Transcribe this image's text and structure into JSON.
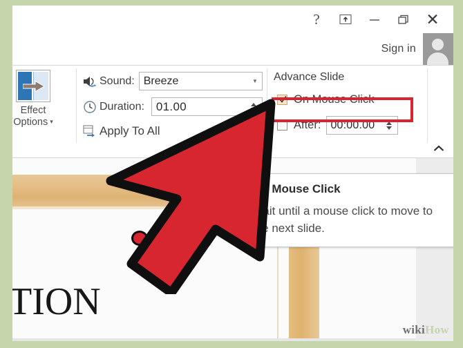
{
  "window": {
    "title_bar_buttons": [
      {
        "name": "help",
        "glyph": "?"
      },
      {
        "name": "ribbon-display-options",
        "glyph": ""
      },
      {
        "name": "minimize",
        "glyph": ""
      },
      {
        "name": "restore",
        "glyph": ""
      },
      {
        "name": "close",
        "glyph": "✕"
      }
    ],
    "sign_in_label": "Sign in"
  },
  "ribbon": {
    "effect_options": {
      "line1": "Effect",
      "line2": "Options",
      "caret": "▾"
    },
    "timing": {
      "sound_label": "Sound:",
      "sound_value": "Breeze",
      "duration_label": "Duration:",
      "duration_value": "01.00",
      "apply_to_all_label": "Apply To All"
    },
    "advance_slide": {
      "header": "Advance Slide",
      "on_mouse_click_label": "On Mouse Click",
      "on_mouse_click_checked": true,
      "after_label": "After:",
      "after_value": "00:00.00",
      "after_checked": false
    },
    "collapse_button_glyph": "⌃"
  },
  "tooltip": {
    "title": "On Mouse Click",
    "body": "Wait until a mouse click to move to the next slide."
  },
  "slide": {
    "title_text": "TION"
  },
  "watermark": {
    "text_left": "wiki",
    "text_right": "How"
  },
  "colors": {
    "highlight_red": "#d9232e",
    "cursor_red": "#d7262f",
    "frame_green": "#c5d6ad",
    "accent_blue": "#2e75b6",
    "checkbox_highlight": "#fce4c8"
  }
}
